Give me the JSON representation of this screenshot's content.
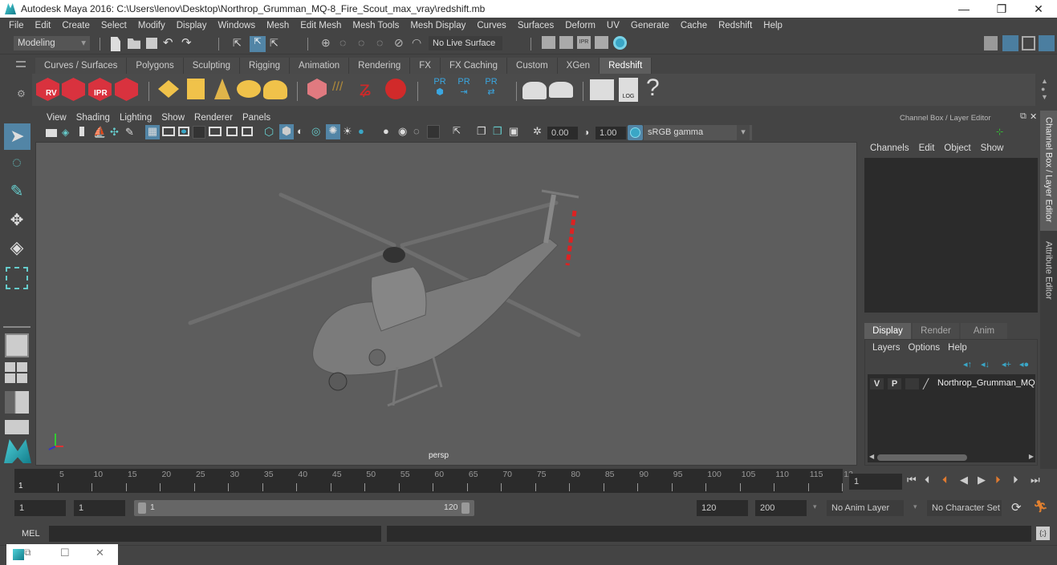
{
  "window": {
    "title": "Autodesk Maya 2016: C:\\Users\\lenov\\Desktop\\Northrop_Grumman_MQ-8_Fire_Scout_max_vray\\redshift.mb",
    "minimize": "—",
    "restore": "❐",
    "close": "✕"
  },
  "menubar": [
    "File",
    "Edit",
    "Create",
    "Select",
    "Modify",
    "Display",
    "Windows",
    "Mesh",
    "Edit Mesh",
    "Mesh Tools",
    "Mesh Display",
    "Curves",
    "Surfaces",
    "Deform",
    "UV",
    "Generate",
    "Cache",
    "Redshift",
    "Help"
  ],
  "statusline": {
    "menuset": "Modeling",
    "live_surface": "No Live Surface"
  },
  "shelf": {
    "tabs": [
      "Curves / Surfaces",
      "Polygons",
      "Sculpting",
      "Rigging",
      "Animation",
      "Rendering",
      "FX",
      "FX Caching",
      "Custom",
      "XGen",
      "Redshift"
    ],
    "active_tab": "Redshift",
    "icons": {
      "rv": "RV",
      "ipr": "IPR",
      "pr": "PR",
      "log": "LOG",
      "help": "?"
    }
  },
  "panel": {
    "menu": [
      "View",
      "Shading",
      "Lighting",
      "Show",
      "Renderer",
      "Panels"
    ],
    "exposure": "0.00",
    "gamma": "1.00",
    "color_space": "sRGB gamma",
    "camera_label": "persp",
    "axis": {
      "x": "x",
      "y": "y",
      "z": "z"
    }
  },
  "channelbox": {
    "title": "Channel Box / Layer Editor",
    "menu": [
      "Channels",
      "Edit",
      "Object",
      "Show"
    ],
    "side_tabs": [
      "Channel Box / Layer Editor",
      "Attribute Editor"
    ]
  },
  "layereditor": {
    "tabs": [
      "Display",
      "Render",
      "Anim"
    ],
    "active_tab": "Display",
    "menu": [
      "Layers",
      "Options",
      "Help"
    ],
    "layers": [
      {
        "v": "V",
        "p": "P",
        "name": "Northrop_Grumman_MQ"
      }
    ]
  },
  "timeslider": {
    "ticks": [
      "5",
      "10",
      "15",
      "20",
      "25",
      "30",
      "35",
      "40",
      "45",
      "50",
      "55",
      "60",
      "65",
      "70",
      "75",
      "80",
      "85",
      "90",
      "95",
      "100",
      "105",
      "110",
      "115",
      "12"
    ],
    "start_label": "1",
    "current_frame": "1"
  },
  "range": {
    "start_time": "1",
    "playback_start": "1",
    "slider_min": "1",
    "slider_max": "120",
    "playback_end": "120",
    "end_time": "200",
    "anim_layer": "No Anim Layer",
    "character_set": "No Character Set"
  },
  "cmdline": {
    "label": "MEL"
  }
}
